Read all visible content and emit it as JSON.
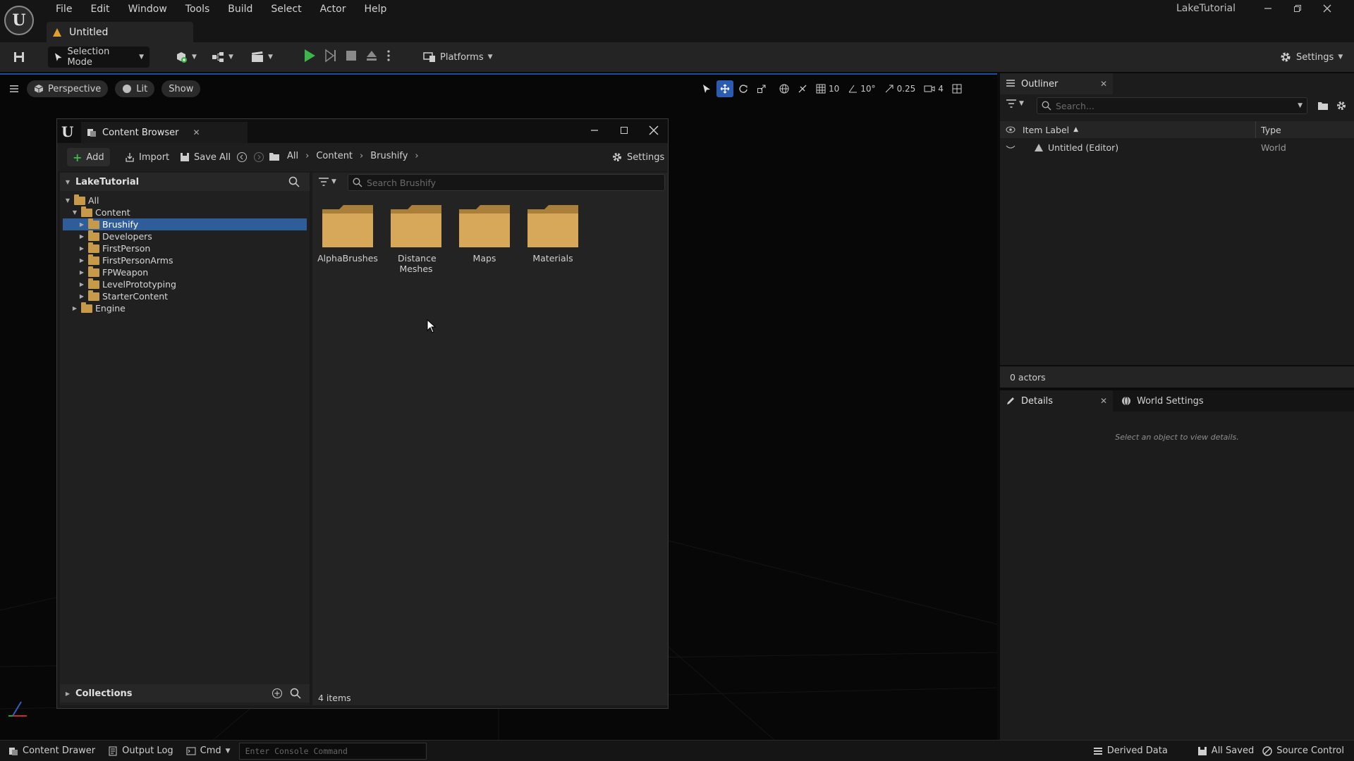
{
  "app": {
    "title": "LakeTutorial",
    "document_tab": "Untitled",
    "menu": [
      "File",
      "Edit",
      "Window",
      "Tools",
      "Build",
      "Select",
      "Actor",
      "Help"
    ]
  },
  "toolbar": {
    "mode": "Selection Mode",
    "platforms": "Platforms",
    "settings": "Settings"
  },
  "viewport": {
    "perspective": "Perspective",
    "lit": "Lit",
    "show": "Show",
    "grid_snap": "10",
    "rotation_snap": "10°",
    "scale_snap": "0.25",
    "camera_speed": "4"
  },
  "content_browser": {
    "tab_title": "Content Browser",
    "add": "Add",
    "import": "Import",
    "save_all": "Save All",
    "settings": "Settings",
    "breadcrumb": [
      "All",
      "Content",
      "Brushify"
    ],
    "project_header": "LakeTutorial",
    "search_placeholder": "Search Brushify",
    "tree": [
      {
        "label": "All",
        "depth": 0,
        "expanded": true
      },
      {
        "label": "Content",
        "depth": 1,
        "expanded": true
      },
      {
        "label": "Brushify",
        "depth": 2,
        "selected": true
      },
      {
        "label": "Developers",
        "depth": 2
      },
      {
        "label": "FirstPerson",
        "depth": 2
      },
      {
        "label": "FirstPersonArms",
        "depth": 2
      },
      {
        "label": "FPWeapon",
        "depth": 2
      },
      {
        "label": "LevelPrototyping",
        "depth": 2
      },
      {
        "label": "StarterContent",
        "depth": 2
      },
      {
        "label": "Engine",
        "depth": 1
      }
    ],
    "folders": [
      "AlphaBrushes",
      "Distance Meshes",
      "Maps",
      "Materials"
    ],
    "item_count": "4 items",
    "collections": "Collections"
  },
  "outliner": {
    "tab": "Outliner",
    "search_placeholder": "Search...",
    "col_label": "Item Label",
    "col_type": "Type",
    "rows": [
      {
        "label": "Untitled (Editor)",
        "type": "World"
      }
    ],
    "actor_count": "0 actors"
  },
  "details": {
    "tab": "Details",
    "world_settings_tab": "World Settings",
    "empty_message": "Select an object to view details."
  },
  "statusbar": {
    "content_drawer": "Content Drawer",
    "output_log": "Output Log",
    "cmd": "Cmd",
    "console_placeholder": "Enter Console Command",
    "derived_data": "Derived Data",
    "all_saved": "All Saved",
    "source_control": "Source Control"
  },
  "colors": {
    "accent": "#2b5cb0",
    "folder": "#c79a4a",
    "play": "#3db54a",
    "selection": "#2f5d9a"
  }
}
